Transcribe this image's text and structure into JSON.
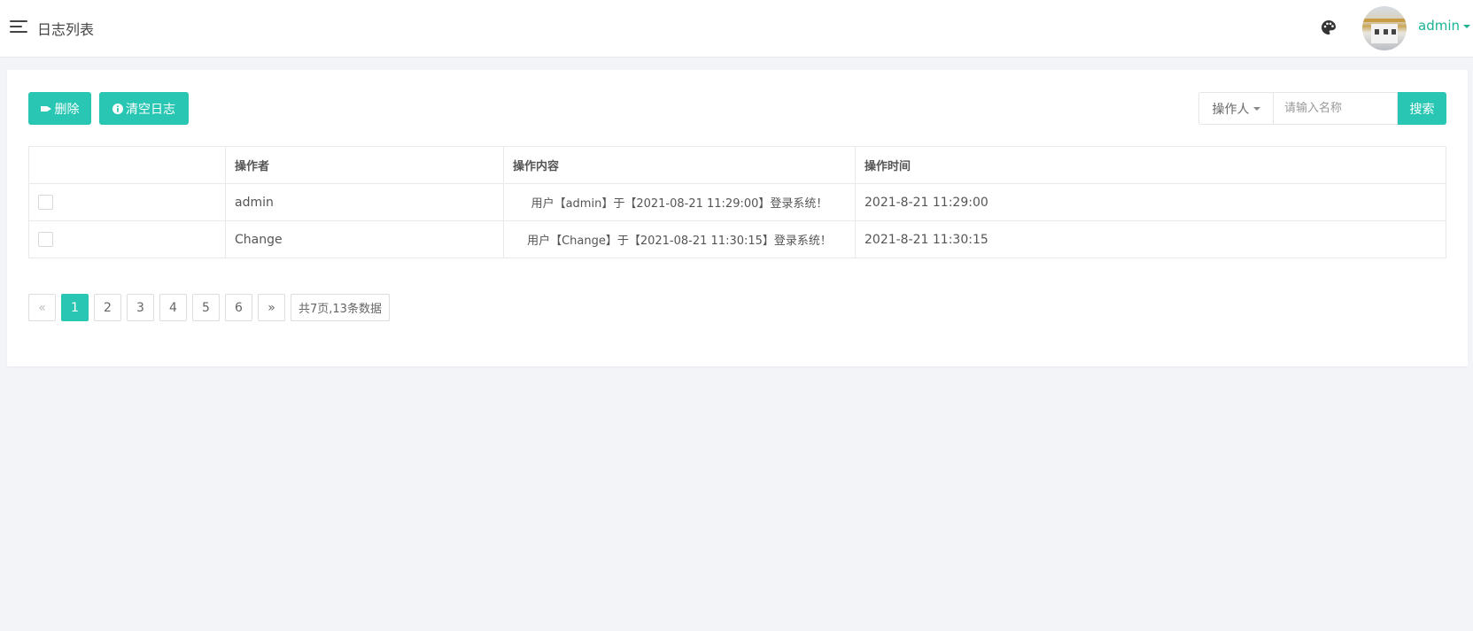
{
  "header": {
    "title": "日志列表",
    "username": "admin"
  },
  "toolbar": {
    "delete_label": "删除",
    "clear_label": "清空日志"
  },
  "search": {
    "field_label": "操作人",
    "placeholder": "请输入名称",
    "button_label": "搜索"
  },
  "table": {
    "headers": [
      "",
      "操作者",
      "操作内容",
      "操作时间"
    ],
    "rows": [
      {
        "operator": "admin",
        "content": "用户【admin】于【2021-08-21 11:29:00】登录系统！",
        "time": "2021-8-21 11:29:00"
      },
      {
        "operator": "Change",
        "content": "用户【Change】于【2021-08-21 11:30:15】登录系统！",
        "time": "2021-8-21 11:30:15"
      }
    ]
  },
  "pagination": {
    "prev": "«",
    "pages": [
      "1",
      "2",
      "3",
      "4",
      "5",
      "6"
    ],
    "next": "»",
    "summary": "共7页,13条数据",
    "current": "1"
  },
  "colors": {
    "accent": "#29c6b4",
    "time_text": "#23b24c",
    "background": "#f3f4f8"
  }
}
